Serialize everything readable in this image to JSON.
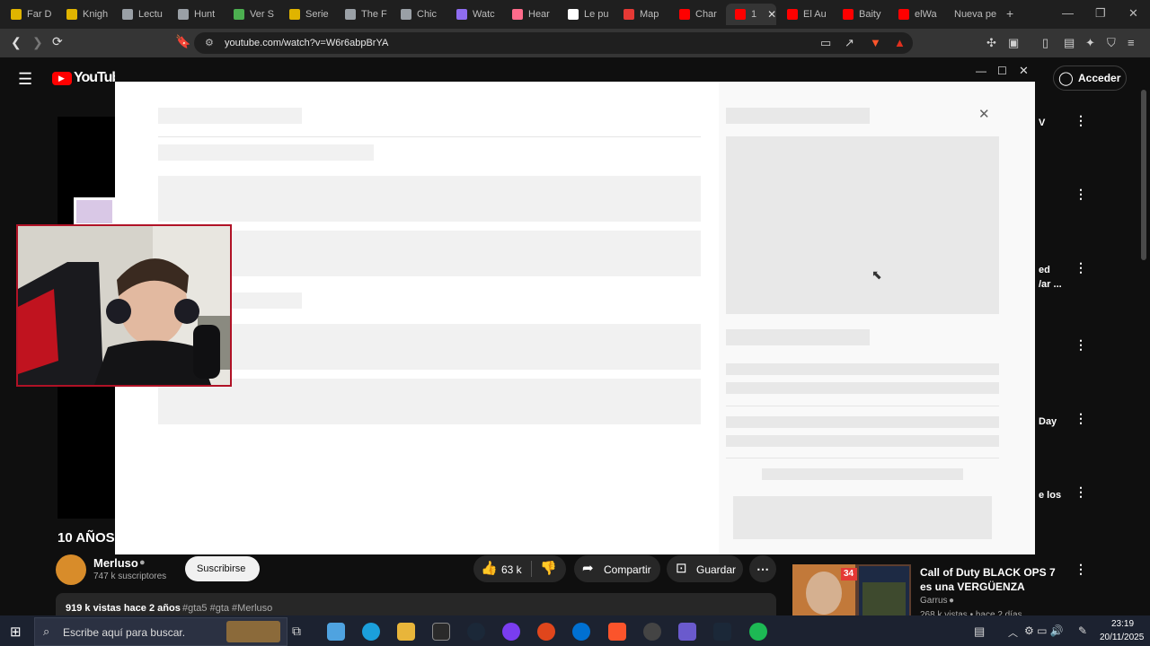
{
  "browser": {
    "tabs": [
      {
        "label": "Far D",
        "color": "#e0b400"
      },
      {
        "label": "Knigh",
        "color": "#e0b400"
      },
      {
        "label": "Lectu",
        "color": "#9aa0a6"
      },
      {
        "label": "Hunt",
        "color": "#9aa0a6"
      },
      {
        "label": "Ver S",
        "color": "#4caf50"
      },
      {
        "label": "Serie",
        "color": "#e0b400"
      },
      {
        "label": "The F",
        "color": "#9aa0a6"
      },
      {
        "label": "Chic",
        "color": "#9aa0a6"
      },
      {
        "label": "Watc",
        "color": "#8e6cf0"
      },
      {
        "label": "Hear",
        "color": "#ff6b8b"
      },
      {
        "label": "Le pu",
        "color": "#ffffff"
      },
      {
        "label": "Map",
        "color": "#e53935"
      },
      {
        "label": "Char",
        "color": "#ff0000"
      },
      {
        "label": "1",
        "color": "#ff0000"
      },
      {
        "label": "El Au",
        "color": "#ff0000"
      },
      {
        "label": "Baity",
        "color": "#ff0000"
      },
      {
        "label": "elWa",
        "color": "#ff0000"
      },
      {
        "label": "Nueva pe",
        "color": ""
      }
    ],
    "new_tab": "+",
    "url": "youtube.com/watch?v=W6r6abpBrYA"
  },
  "youtube": {
    "logo": "YouTube",
    "signin": "Acceder",
    "video_title_partial": "10 AÑOS",
    "channel": "Merluso",
    "subscribers": "747 k suscriptores",
    "subscribe": "Suscribirse",
    "likes": "63 k",
    "share": "Compartir",
    "save": "Guardar",
    "views_line": "919 k vistas  hace 2 años",
    "hashtags": "#gta5 #gta #Merluso",
    "side_fragments": [
      "V",
      "ed",
      "/ar ...",
      "Day",
      "e los"
    ],
    "rec": {
      "title": "Call of Duty BLACK OPS 7 es una VERGÜENZA",
      "channel": "Garrus",
      "meta": "268 k vistas • hace 2 días",
      "badge": "34"
    }
  },
  "taskbar": {
    "search_placeholder": "Escribe aquí para buscar.",
    "time": "23:19",
    "date": "20/11/2025"
  }
}
